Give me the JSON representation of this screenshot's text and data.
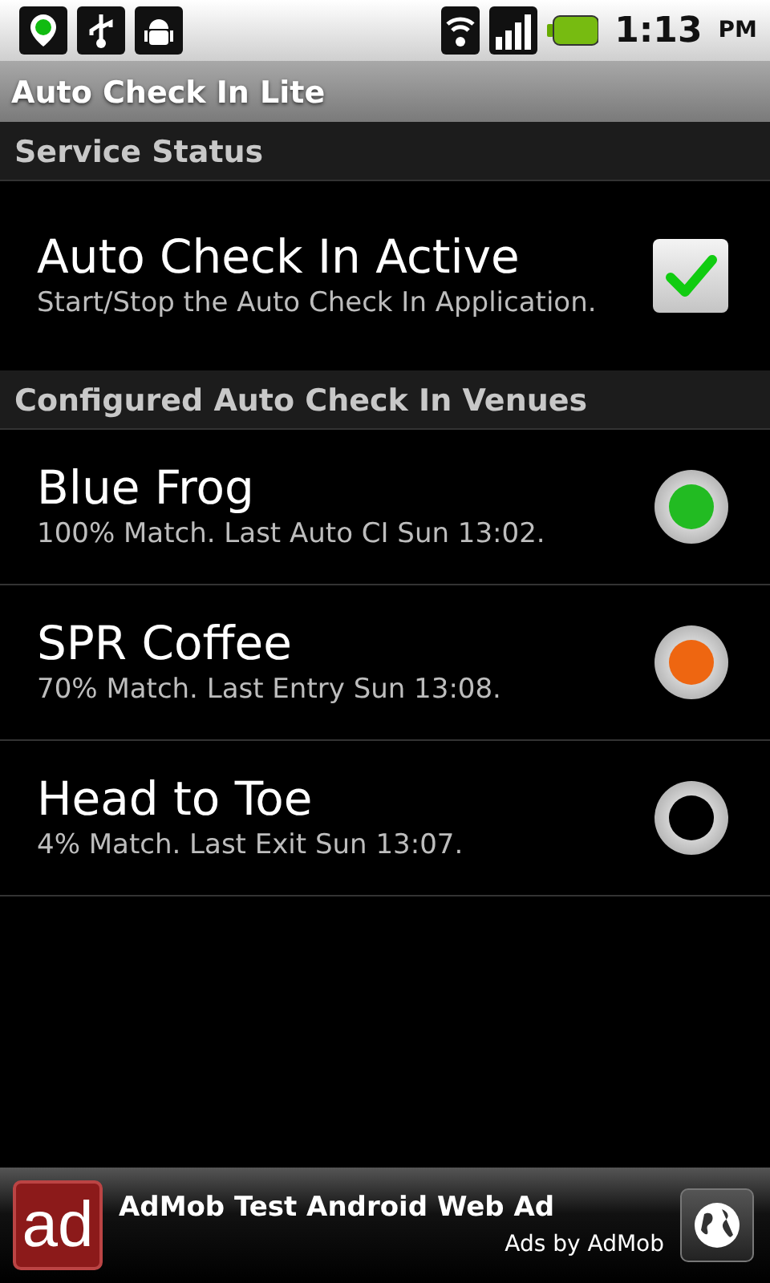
{
  "status_bar": {
    "time": "1:13",
    "ampm": "PM"
  },
  "title": "Auto Check In Lite",
  "sections": [
    {
      "header": "Service Status",
      "items": [
        {
          "kind": "checkbox",
          "title": "Auto Check In Active",
          "summary": "Start/Stop the Auto Check In Application.",
          "checked": true
        }
      ]
    },
    {
      "header": "Configured Auto Check In Venues",
      "items": [
        {
          "kind": "venue",
          "title": "Blue Frog",
          "summary": "100% Match. Last Auto CI Sun 13:02.",
          "color": "#22bb22"
        },
        {
          "kind": "venue",
          "title": "SPR Coffee",
          "summary": "70% Match. Last Entry Sun 13:08.",
          "color": "#ee6611"
        },
        {
          "kind": "venue",
          "title": "Head to Toe",
          "summary": "4% Match. Last Exit Sun 13:07.",
          "color": "#000000"
        }
      ]
    }
  ],
  "ad": {
    "logo": "ad",
    "headline": "AdMob Test Android Web Ad",
    "attribution": "Ads by AdMob"
  }
}
